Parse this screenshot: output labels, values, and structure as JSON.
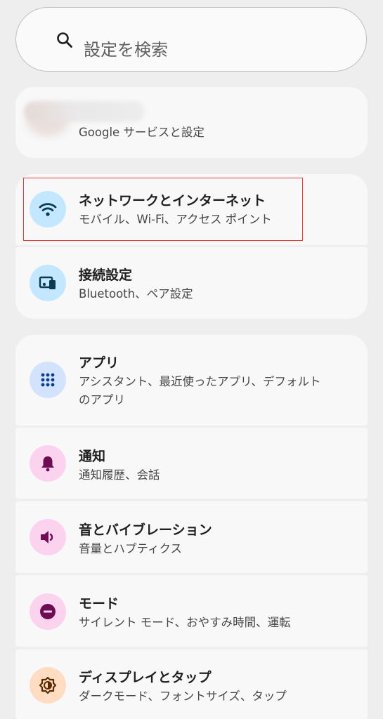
{
  "search": {
    "placeholder": "設定を検索",
    "icon": "search-icon"
  },
  "account": {
    "subtitle": "Google サービスと設定"
  },
  "items": [
    {
      "title": "ネットワークとインターネット",
      "subtitle": "モバイル、Wi-Fi、アクセス ポイント",
      "icon": "wifi-icon",
      "icon_bg": "#c2e7ff",
      "icon_color": "#0b3b52"
    },
    {
      "title": "接続設定",
      "subtitle": "Bluetooth、ペア設定",
      "icon": "devices-icon",
      "icon_bg": "#c2e7ff",
      "icon_color": "#0b3b52"
    },
    {
      "title": "アプリ",
      "subtitle_line1": "アシスタント、最近使ったアプリ、デフォルト",
      "subtitle_line2": "のアプリ",
      "icon": "apps-grid-icon",
      "icon_bg": "#d3e3fd",
      "icon_color": "#0b3d91"
    },
    {
      "title": "通知",
      "subtitle": "通知履歴、会話",
      "icon": "bell-icon",
      "icon_bg": "#fbd3ee",
      "icon_color": "#6e0d54"
    },
    {
      "title": "音とバイブレーション",
      "subtitle": "音量とハプティクス",
      "icon": "speaker-icon",
      "icon_bg": "#fbd3ee",
      "icon_color": "#6e0d54"
    },
    {
      "title": "モード",
      "subtitle": "サイレント モード、おやすみ時間、運転",
      "icon": "do-not-disturb-icon",
      "icon_bg": "#fbd3ee",
      "icon_color": "#6e0d54"
    },
    {
      "title": "ディスプレイとタップ",
      "subtitle": "ダークモード、フォントサイズ、タップ",
      "icon": "brightness-icon",
      "icon_bg": "#ffdcc2",
      "icon_color": "#5a2a00"
    }
  ],
  "highlight_color": "#e53935"
}
